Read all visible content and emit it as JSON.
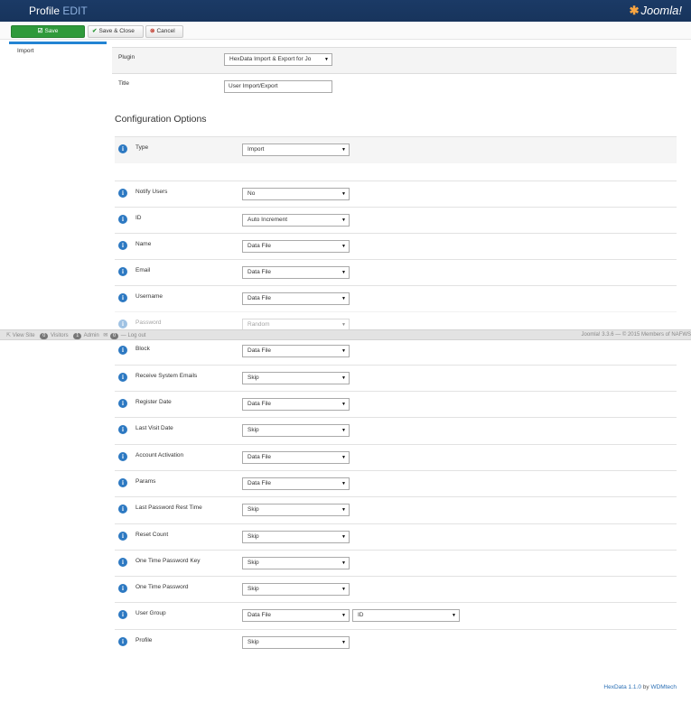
{
  "header": {
    "title": "Profile",
    "subtitle": "EDIT",
    "logo_text": "Joomla!"
  },
  "toolbar": {
    "save_label": "Save",
    "save_close_label": "Save & Close",
    "cancel_label": "Cancel"
  },
  "sidebar": {
    "items": [
      {
        "label": "Import"
      }
    ]
  },
  "form": {
    "plugin_label": "Plugin",
    "plugin_value": "HexData Import & Export for Jo",
    "title_label": "Title",
    "title_value": "User Import/Export"
  },
  "config": {
    "heading": "Configuration Options",
    "rows": [
      {
        "label": "Type",
        "value": "Import"
      },
      {
        "label": "Notify Users",
        "value": "No"
      },
      {
        "label": "ID",
        "value": "Auto Increment"
      },
      {
        "label": "Name",
        "value": "Data File"
      },
      {
        "label": "Email",
        "value": "Data File"
      },
      {
        "label": "Username",
        "value": "Data File"
      },
      {
        "label": "Password",
        "value": "Random"
      },
      {
        "label": "Block",
        "value": "Data File"
      },
      {
        "label": "Receive System Emails",
        "value": "Skip"
      },
      {
        "label": "Register Date",
        "value": "Data File"
      },
      {
        "label": "Last Visit Date",
        "value": "Skip"
      },
      {
        "label": "Account Activation",
        "value": "Data File"
      },
      {
        "label": "Params",
        "value": "Data File"
      },
      {
        "label": "Last Password Rest Time",
        "value": "Skip"
      },
      {
        "label": "Reset Count",
        "value": "Skip"
      },
      {
        "label": "One Time Password Key",
        "value": "Skip"
      },
      {
        "label": "One Time Password",
        "value": "Skip"
      },
      {
        "label": "User Group",
        "value": "Data File",
        "value2": "ID"
      },
      {
        "label": "Profile",
        "value": "Skip"
      }
    ]
  },
  "statusbar": {
    "view_site": "View Site",
    "visitors_count": "0",
    "visitors_label": "Visitors",
    "admin_count": "1",
    "admin_label": "Admin",
    "messages_count": "0",
    "logout": "Log out",
    "version": "Joomla! 3.3.6 — © 2015 Members of NAFWS"
  },
  "footer": {
    "product": "HexData 1.1.0",
    "by": "by",
    "vendor": "WDMtech"
  }
}
